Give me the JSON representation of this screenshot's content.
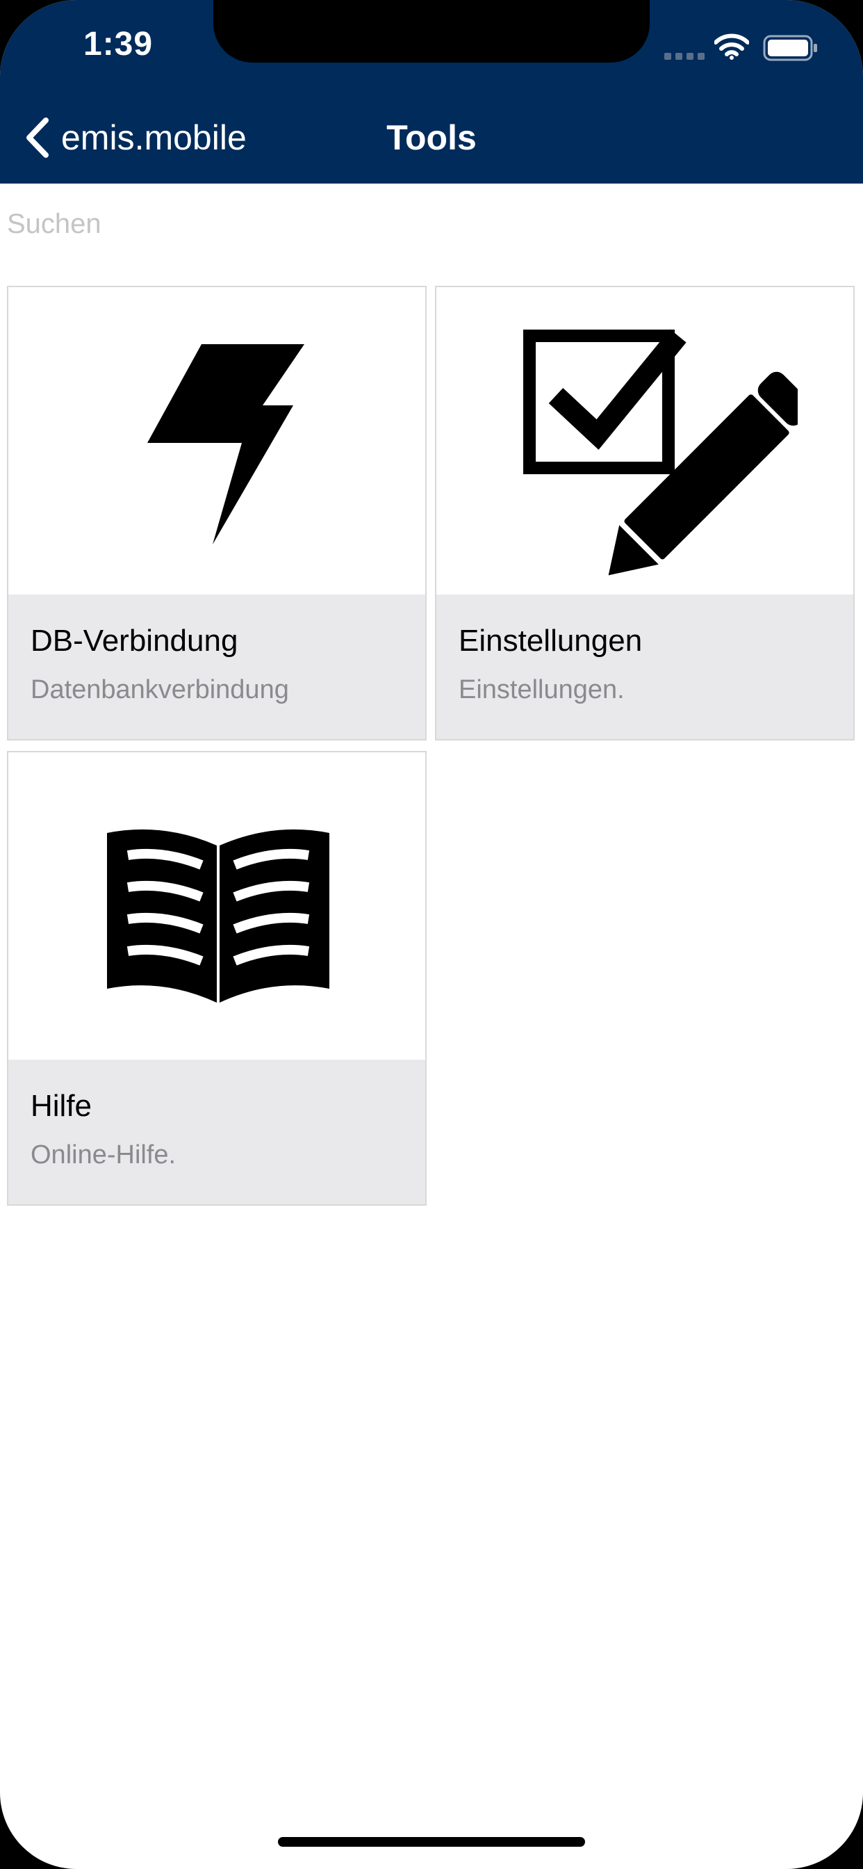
{
  "status_bar": {
    "time": "1:39"
  },
  "nav": {
    "back_label": "emis.mobile",
    "title": "Tools"
  },
  "search": {
    "placeholder": "Suchen",
    "value": ""
  },
  "tiles": [
    {
      "title": "DB-Verbindung",
      "subtitle": "Datenbankverbindung",
      "icon": "lightning-bolt-icon"
    },
    {
      "title": "Einstellungen",
      "subtitle": "Einstellungen.",
      "icon": "checkbox-pencil-icon"
    },
    {
      "title": "Hilfe",
      "subtitle": "Online-Hilfe.",
      "icon": "open-book-icon"
    }
  ],
  "colors": {
    "header_bg": "#002b5b",
    "caption_bg": "#e9e9eb",
    "subtitle_text": "#8a8a8e",
    "placeholder_text": "#c4c4c6"
  }
}
